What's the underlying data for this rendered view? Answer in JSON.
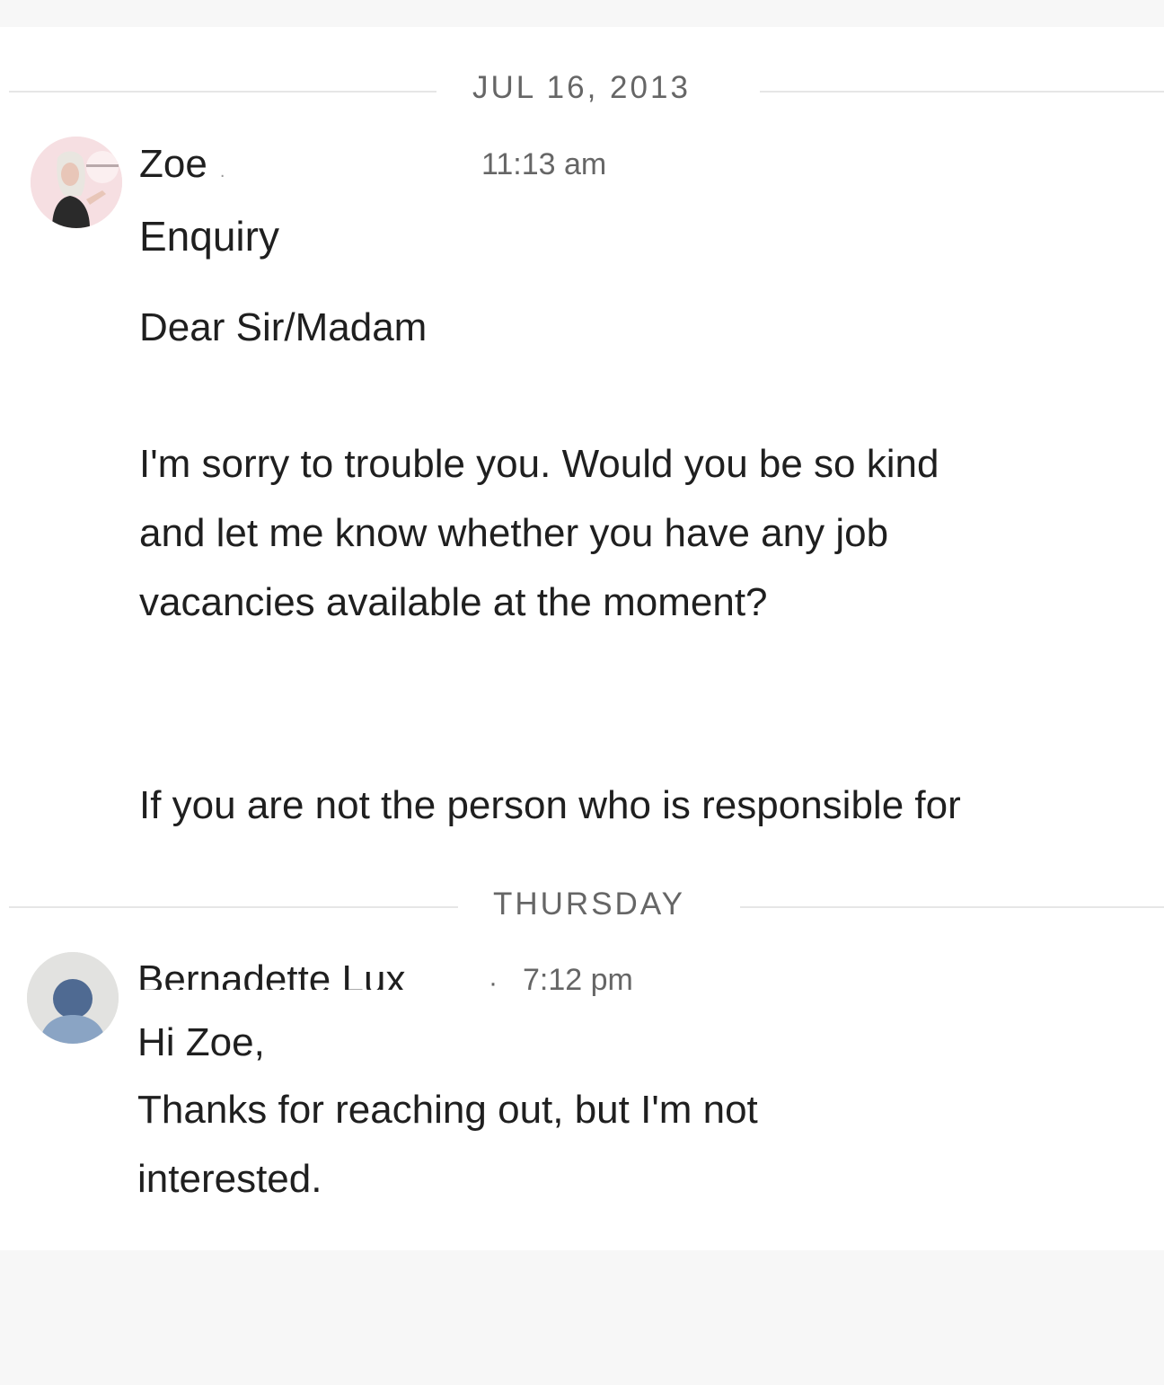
{
  "thread": {
    "date_dividers": {
      "first": "JUL 16, 2013",
      "second": "THURSDAY"
    },
    "messages": [
      {
        "sender": "Zoe",
        "sender_suffix": ".",
        "time": "11:13 am",
        "subject": "Enquiry",
        "body_lines": [
          "Dear Sir/Madam",
          "I'm sorry to trouble you. Would you be so kind",
          "and let me know whether you have any job",
          "vacancies available at the moment?",
          "If you are not the person who is responsible for"
        ]
      },
      {
        "sender": "Bernadette Lux",
        "separator": "·",
        "time": "7:12 pm",
        "body_lines": [
          "Hi Zoe,",
          "Thanks for reaching out, but I'm not",
          "interested."
        ]
      }
    ]
  },
  "colors": {
    "background": "#ffffff",
    "outer_background": "#f7f7f7",
    "divider": "#e6e6e6",
    "muted_text": "#666666",
    "text": "#1f1f1f",
    "avatar_generic_bg": "#e2e2e0",
    "avatar_generic_fg": "#8aa4c4"
  },
  "icons": {
    "first_avatar": "profile-photo",
    "second_avatar": "generic-person-icon"
  }
}
